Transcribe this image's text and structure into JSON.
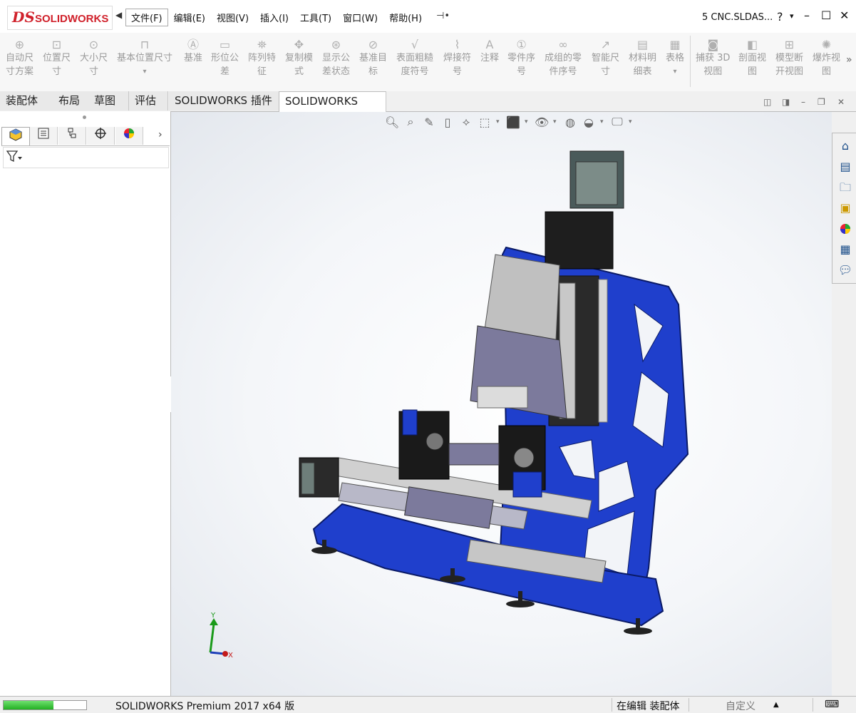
{
  "app": {
    "logo_mark": "DS",
    "logo_text": "SOLIDWORKS",
    "document_title": "5 CNC.SLDAS...",
    "help_symbol": "?",
    "window_controls": [
      "–",
      "☐",
      "✕"
    ]
  },
  "menubar": {
    "items": [
      "文件(F)",
      "编辑(E)",
      "视图(V)",
      "插入(I)",
      "工具(T)",
      "窗口(W)",
      "帮助(H)"
    ]
  },
  "ribbon": {
    "buttons": [
      {
        "label1": "自动尺",
        "label2": "寸方案",
        "icon": "auto-dimension-icon"
      },
      {
        "label1": "位置尺",
        "label2": "寸",
        "icon": "location-dimension-icon"
      },
      {
        "label1": "大小尺",
        "label2": "寸",
        "icon": "size-dimension-icon"
      },
      {
        "label1": "基本位置尺寸",
        "label2": "",
        "icon": "basic-location-dimension-icon"
      },
      {
        "label1": "基准",
        "label2": "",
        "icon": "datum-icon"
      },
      {
        "label1": "形位公",
        "label2": "差",
        "icon": "geometric-tolerance-icon"
      },
      {
        "label1": "阵列特",
        "label2": "征",
        "icon": "pattern-feature-icon"
      },
      {
        "label1": "复制模",
        "label2": "式",
        "icon": "copy-scheme-icon"
      },
      {
        "label1": "显示公",
        "label2": "差状态",
        "icon": "show-tolerance-status-icon"
      },
      {
        "label1": "基准目",
        "label2": "标",
        "icon": "datum-target-icon"
      },
      {
        "label1": "表面粗糙",
        "label2": "度符号",
        "icon": "surface-finish-icon"
      },
      {
        "label1": "焊接符",
        "label2": "号",
        "icon": "weld-symbol-icon"
      },
      {
        "label1": "注释",
        "label2": "",
        "icon": "note-icon"
      },
      {
        "label1": "零件序",
        "label2": "号",
        "icon": "balloon-icon"
      },
      {
        "label1": "成组的零",
        "label2": "件序号",
        "icon": "stacked-balloon-icon"
      },
      {
        "label1": "智能尺",
        "label2": "寸",
        "icon": "smart-dimension-icon"
      },
      {
        "label1": "材料明",
        "label2": "细表",
        "icon": "bill-of-materials-icon"
      },
      {
        "label1": "表格",
        "label2": "",
        "icon": "table-icon"
      },
      {
        "label1": "捕获 3D",
        "label2": "视图",
        "icon": "capture-3d-view-icon"
      },
      {
        "label1": "剖面视",
        "label2": "图",
        "icon": "section-view-icon"
      },
      {
        "label1": "模型断",
        "label2": "开视图",
        "icon": "model-break-view-icon"
      },
      {
        "label1": "爆炸视",
        "label2": "图",
        "icon": "exploded-view-icon"
      }
    ],
    "more": "»"
  },
  "tabs": [
    "装配体",
    "布局",
    "草图",
    "评估",
    "SOLIDWORKS 插件",
    "SOLIDWORKS MBD"
  ],
  "statusbar": {
    "progress_percent": 60,
    "product": "SOLIDWORKS Premium 2017 x64 版",
    "edit_state": "在编辑 装配体",
    "custom": "自定义"
  },
  "triad": {
    "y": "Y",
    "x": "X"
  },
  "colors": {
    "frame_blue": "#1f3fcc",
    "logo_red": "#d0212b",
    "progress_green": "#23b023"
  }
}
